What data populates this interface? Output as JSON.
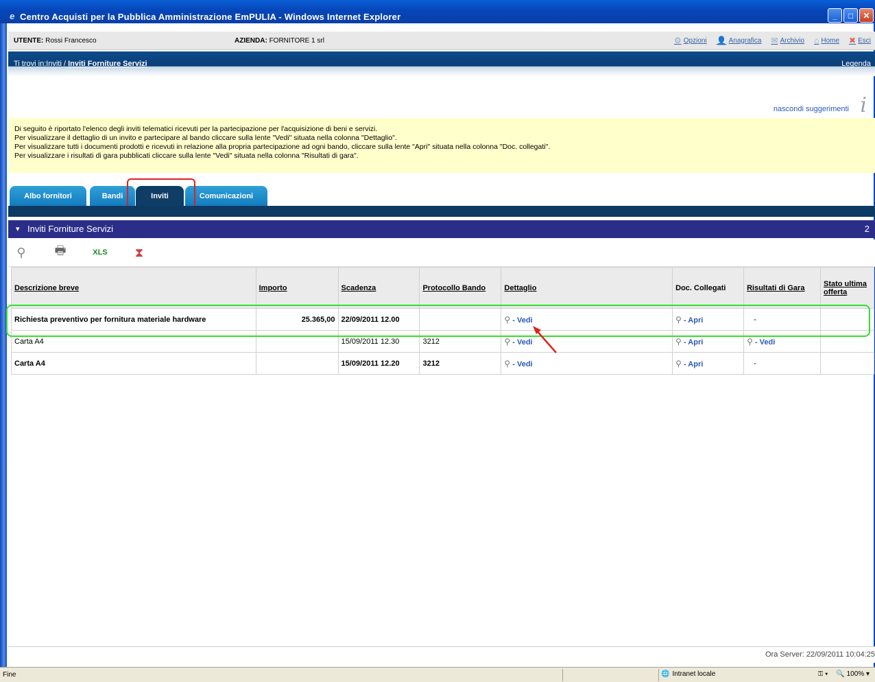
{
  "window": {
    "title": "Centro Acquisti per la Pubblica Amministrazione EmPULIA - Windows Internet Explorer"
  },
  "userbar": {
    "user_label": "UTENTE:",
    "user_value": "Rossi Francesco",
    "company_label": "AZIENDA:",
    "company_value": "FORNITORE 1 srl",
    "nav": [
      {
        "label": "Opzioni",
        "icon": "gear-icon"
      },
      {
        "label": "Anagrafica",
        "icon": "person-icon"
      },
      {
        "label": "Archivio",
        "icon": "archive-icon"
      },
      {
        "label": "Home",
        "icon": "home-icon"
      },
      {
        "label": "Esci",
        "icon": "exit-icon"
      }
    ]
  },
  "breadcrumb": {
    "prefix": "Ti trovi in:Inviti / ",
    "current": "Inviti Forniture Servizi",
    "legend": "Legenda"
  },
  "tips": {
    "hide_label": "nascondi suggerimenti",
    "lines": [
      "Di seguito è riportato l'elenco degli inviti telematici ricevuti per la partecipazione per l'acquisizione di beni e servizi.",
      "Per visualizzare il dettaglio di un invito e partecipare al bando cliccare sulla lente \"Vedi\" situata nella colonna \"Dettaglio\".",
      "Per visualizzare tutti i documenti prodotti e ricevuti in relazione alla propria partecipazione ad ogni bando, cliccare sulla lente \"Apri\" situata nella colonna \"Doc. collegati\".",
      "Per visualizzare i risultati di gara pubblicati cliccare sulla lente \"Vedi\" situata nella colonna \"Risultati di gara\"."
    ]
  },
  "tabs": [
    {
      "label": "Albo fornitori",
      "active": false
    },
    {
      "label": "Bandi",
      "active": false
    },
    {
      "label": "Inviti",
      "active": true
    },
    {
      "label": "Comunicazioni",
      "active": false
    }
  ],
  "section": {
    "title": "Inviti Forniture Servizi",
    "count": "2"
  },
  "toolbar": [
    "search-icon",
    "print-icon",
    "excel-icon",
    "hourglass-icon"
  ],
  "table": {
    "headers": {
      "descrizione": "Descrizione breve",
      "importo": "Importo",
      "scadenza": "Scadenza",
      "protocollo": "Protocollo Bando",
      "dettaglio": "Dettaglio",
      "doc": "Doc. Collegati",
      "risultati": "Risultati di Gara",
      "stato": "Stato ultima offerta"
    },
    "rows": [
      {
        "descrizione": "Richiesta preventivo per fornitura materiale hardware",
        "importo": "25.365,00",
        "scadenza": "22/09/2011 12.00",
        "protocollo": "",
        "dettaglio": "- Vedi",
        "doc": "- Apri",
        "risultati": "-",
        "stato": "",
        "bold": true
      },
      {
        "descrizione": "Carta A4",
        "importo": "",
        "scadenza": "15/09/2011 12.30",
        "protocollo": "3212",
        "dettaglio": "- Vedi",
        "doc": "- Apri",
        "risultati": "- Vedi",
        "stato": "",
        "bold": false
      },
      {
        "descrizione": "Carta A4",
        "importo": "",
        "scadenza": "15/09/2011 12.20",
        "protocollo": "3212",
        "dettaglio": "- Vedi",
        "doc": "- Apri",
        "risultati": "-",
        "stato": "",
        "bold": true
      }
    ]
  },
  "server": {
    "label": "Ora Server: 22/09/2011 10:04:25"
  },
  "statusbar": {
    "left": "Fine",
    "zone": "Intranet locale",
    "zoom": "100%"
  }
}
